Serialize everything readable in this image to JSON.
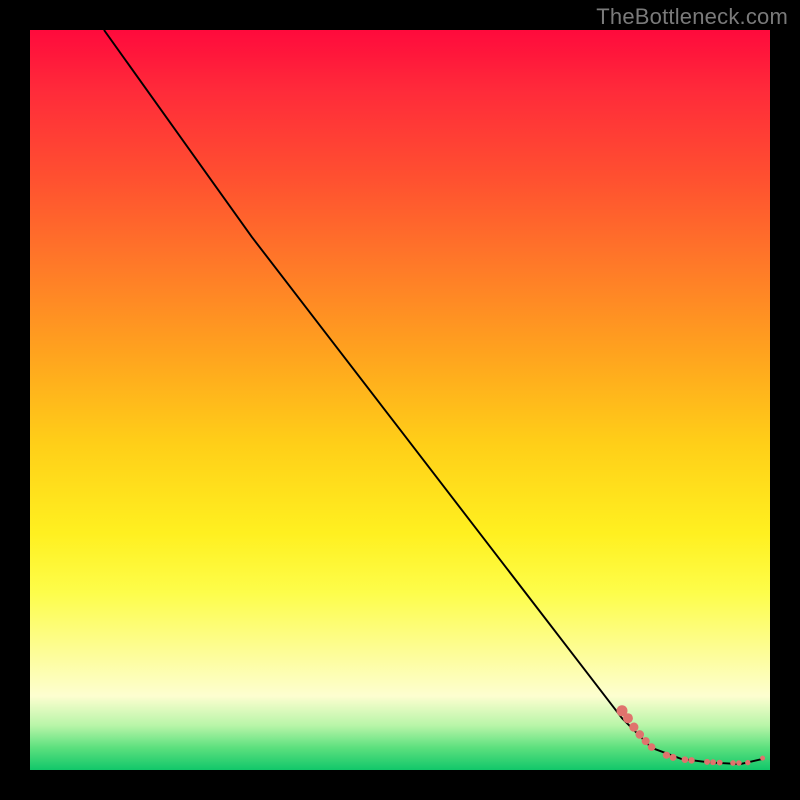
{
  "attribution": "TheBottleneck.com",
  "chart_data": {
    "type": "line",
    "title": "",
    "xlabel": "",
    "ylabel": "",
    "xlim": [
      0,
      100
    ],
    "ylim": [
      0,
      100
    ],
    "grid": false,
    "legend": false,
    "background": "rainbow-vertical",
    "series": [
      {
        "name": "curve",
        "style": "line",
        "color": "#000000",
        "width": 1.2,
        "x": [
          10,
          25,
          30,
          40,
          50,
          60,
          70,
          80,
          84,
          88,
          92,
          96,
          99
        ],
        "y": [
          100,
          79,
          72,
          59,
          46,
          33,
          20,
          7,
          3,
          1.5,
          1,
          0.8,
          1.5
        ]
      },
      {
        "name": "markers",
        "style": "scatter",
        "color": "#e0736d",
        "radius_range": [
          2.5,
          5.5
        ],
        "points": [
          {
            "x": 80.0,
            "y": 8.0,
            "r": 5.5
          },
          {
            "x": 80.8,
            "y": 7.0,
            "r": 5.0
          },
          {
            "x": 81.6,
            "y": 5.8,
            "r": 4.6
          },
          {
            "x": 82.4,
            "y": 4.8,
            "r": 4.3
          },
          {
            "x": 83.2,
            "y": 3.9,
            "r": 4.0
          },
          {
            "x": 84.0,
            "y": 3.1,
            "r": 3.8
          },
          {
            "x": 86.0,
            "y": 2.0,
            "r": 3.6
          },
          {
            "x": 86.9,
            "y": 1.7,
            "r": 3.5
          },
          {
            "x": 88.5,
            "y": 1.4,
            "r": 3.3
          },
          {
            "x": 89.4,
            "y": 1.3,
            "r": 3.2
          },
          {
            "x": 91.5,
            "y": 1.1,
            "r": 3.0
          },
          {
            "x": 92.3,
            "y": 1.05,
            "r": 2.95
          },
          {
            "x": 93.2,
            "y": 1.0,
            "r": 2.9
          },
          {
            "x": 95.0,
            "y": 0.95,
            "r": 2.8
          },
          {
            "x": 95.8,
            "y": 0.95,
            "r": 2.75
          },
          {
            "x": 97.0,
            "y": 1.0,
            "r": 2.7
          },
          {
            "x": 99.0,
            "y": 1.6,
            "r": 2.5
          }
        ]
      }
    ]
  }
}
